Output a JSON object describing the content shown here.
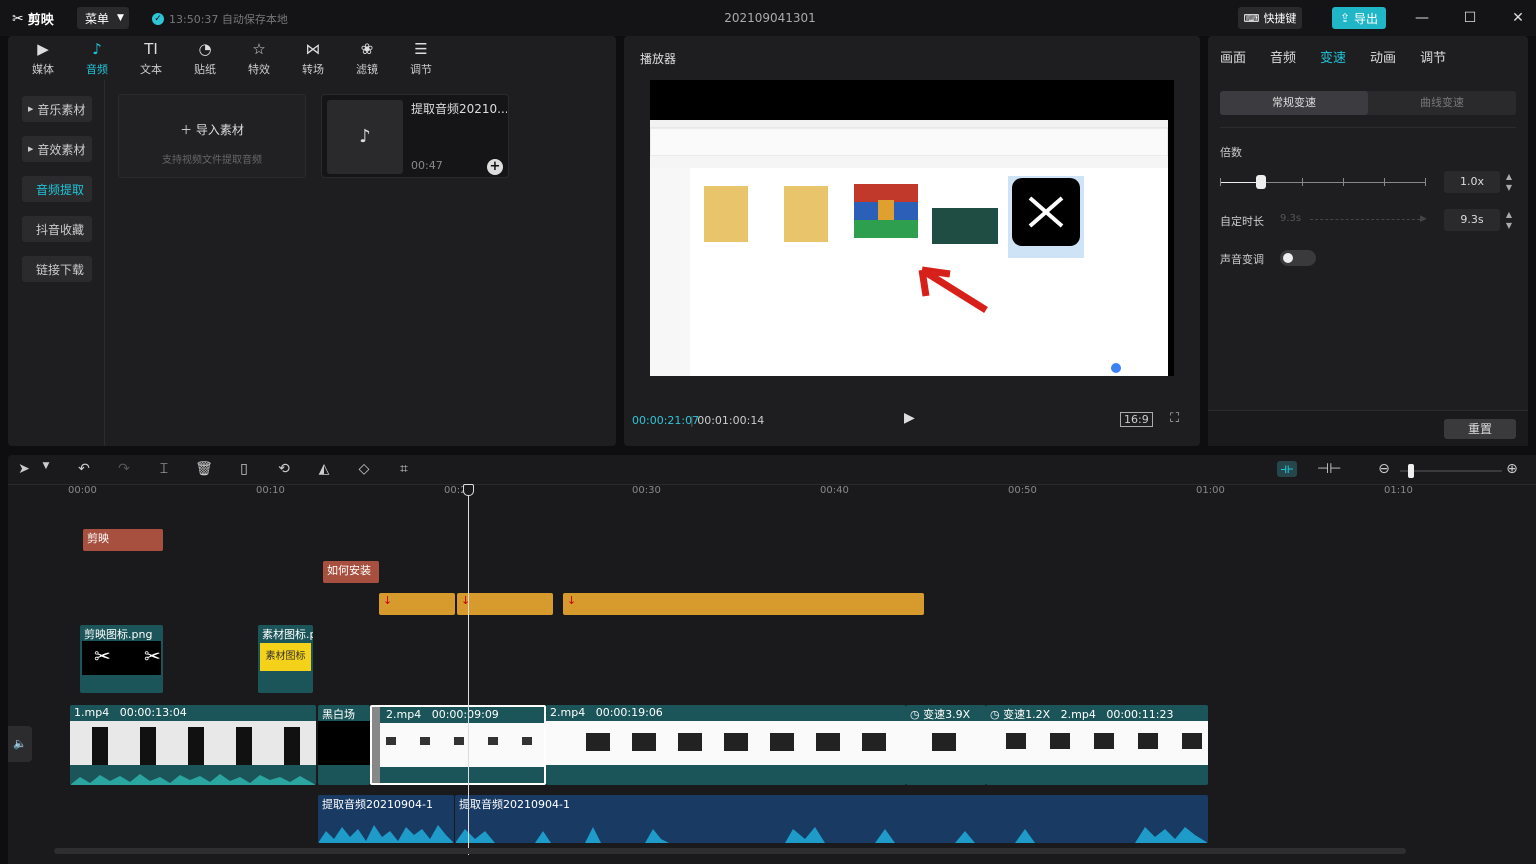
{
  "app": {
    "logo_text": "剪映",
    "menu_label": "菜单",
    "autosave_text": "13:50:37 自动保存本地",
    "project_title": "202109041301",
    "shortcut_label": "快捷键",
    "export_label": "导出",
    "accent": "#20c4d8"
  },
  "toolbar": {
    "tabs": [
      {
        "label": "媒体",
        "icon": "media-icon"
      },
      {
        "label": "音频",
        "icon": "audio-icon"
      },
      {
        "label": "文本",
        "icon": "text-icon"
      },
      {
        "label": "贴纸",
        "icon": "sticker-icon"
      },
      {
        "label": "特效",
        "icon": "effects-icon"
      },
      {
        "label": "转场",
        "icon": "transition-icon"
      },
      {
        "label": "滤镜",
        "icon": "filter-icon"
      },
      {
        "label": "调节",
        "icon": "adjust-icon"
      }
    ],
    "active": "音频"
  },
  "media_sidebar": {
    "items": [
      "音乐素材",
      "音效素材",
      "音频提取",
      "抖音收藏",
      "链接下载"
    ],
    "active": "音频提取"
  },
  "media_panel": {
    "import_label": "导入素材",
    "import_hint": "支持视频文件提取音频",
    "audio_card_name": "提取音频20210...",
    "audio_card_duration": "00:47"
  },
  "player": {
    "title": "播放器",
    "current_time": "00:00:21:07",
    "total_time": "00:01:00:14",
    "aspect_ratio": "16:9"
  },
  "properties": {
    "tabs": [
      "画面",
      "音频",
      "变速",
      "动画",
      "调节"
    ],
    "active_tab": "变速",
    "speed_modes": [
      "常规变速",
      "曲线变速"
    ],
    "multiplier_label": "倍数",
    "multiplier_value": "1.0x",
    "custom_duration_label": "自定时长",
    "custom_duration_hint": "9.3s",
    "custom_duration_value": "9.3s",
    "pitch_label": "声音变调",
    "reset_label": "重置"
  },
  "timeline": {
    "ruler": [
      "00:00",
      "00:10",
      "00:20",
      "00:30",
      "00:40",
      "00:50",
      "01:00",
      "01:10"
    ],
    "text_clips": [
      "剪映",
      "如何安装"
    ],
    "sticker_clips": [
      "剪映图标.png",
      "素材图标.p"
    ],
    "sticker_thumb_text": "素材图标",
    "video_clips": [
      {
        "name": "1.mp4",
        "dur": "00:00:13:04"
      },
      {
        "name": "黑白场",
        "dur": ""
      },
      {
        "name": "2.mp4",
        "dur": "00:00:09:09"
      },
      {
        "name": "2.mp4",
        "dur": "00:00:19:06"
      },
      {
        "name": "变速3.9X",
        "dur": ""
      },
      {
        "name": "变速1.2X",
        "dur": "2.mp4"
      },
      {
        "name": "00:00:11:23",
        "dur": ""
      }
    ],
    "audio_clips": [
      "提取音频20210904-1",
      "提取音频20210904-1"
    ]
  }
}
